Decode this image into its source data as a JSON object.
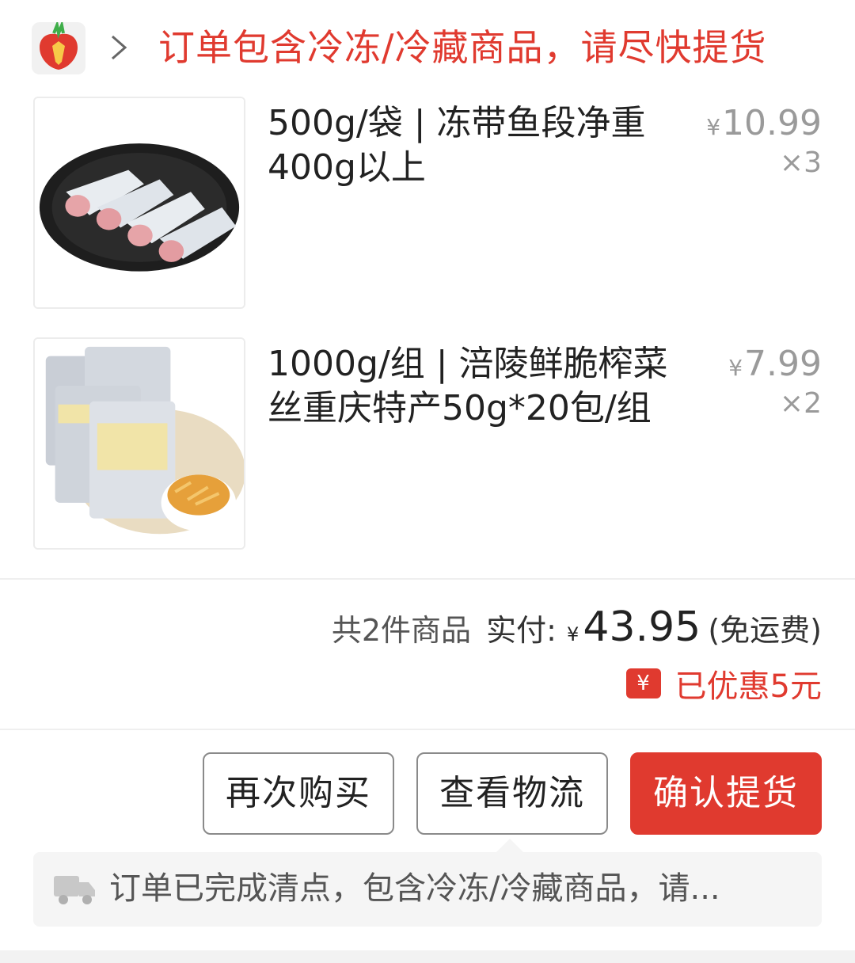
{
  "header": {
    "message": "订单包含冷冻/冷藏商品，请尽快提货",
    "logo_icon": "carrot-logo-icon",
    "chevron_icon": "chevron-right-icon",
    "accent_color": "#e03a2f"
  },
  "items": [
    {
      "name": "500g/袋 | 冻带鱼段净重400g以上",
      "currency": "¥",
      "price": "10.99",
      "qty": "×3",
      "image": "frozen-hairtail-fish-image"
    },
    {
      "name": "1000g/组 | 涪陵鲜脆榨菜丝重庆特产50g*20包/组",
      "currency": "¥",
      "price": "7.99",
      "qty": "×2",
      "image": "pickled-mustard-image"
    }
  ],
  "summary": {
    "count_text": "共2件商品",
    "paid_label": "实付:",
    "currency": "¥",
    "amount": "43.95",
    "shipping": "(免运费)",
    "discount_badge": "¥",
    "discount_text": "已优惠5元"
  },
  "actions": {
    "rebuy": "再次购买",
    "track": "查看物流",
    "confirm": "确认提货"
  },
  "notice": {
    "truck_icon": "delivery-truck-icon",
    "text": "订单已完成清点，包含冷冻/冷藏商品，请..."
  }
}
